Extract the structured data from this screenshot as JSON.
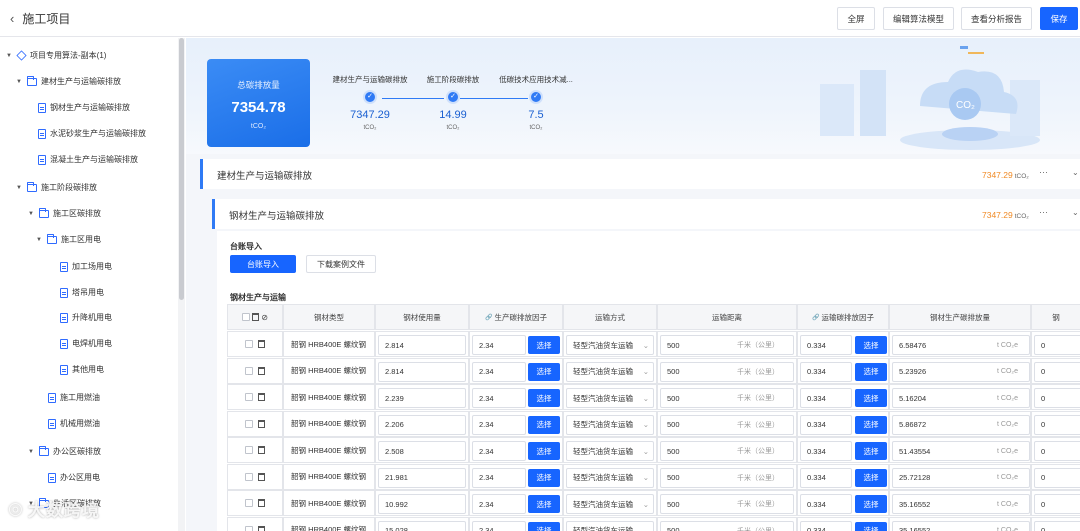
{
  "header": {
    "back_label": "施工项目",
    "buttons": [
      "全屏",
      "编辑算法模型",
      "查看分析报告",
      "保存"
    ]
  },
  "sidebar": {
    "items": [
      {
        "label": "项目专用算法-副本(1)",
        "level": 0,
        "icon": "cube-icon",
        "expandable": true
      },
      {
        "label": "建材生产与运输碳排放",
        "level": 1,
        "icon": "folder-icon",
        "expandable": true
      },
      {
        "label": "钢材生产与运输碳排放",
        "level": 2,
        "icon": "document-icon",
        "expandable": false
      },
      {
        "label": "水泥砂浆生产与运输碳排放",
        "level": 2,
        "icon": "document-icon",
        "expandable": false
      },
      {
        "label": "混凝土生产与运输碳排放",
        "level": 2,
        "icon": "document-icon",
        "expandable": false
      },
      {
        "label": "施工阶段碳排放",
        "level": 1,
        "icon": "folder-icon",
        "expandable": true
      },
      {
        "label": "施工区碳排放",
        "level": 2,
        "icon": "folder-icon",
        "expandable": true
      },
      {
        "label": "施工区用电",
        "level": 3,
        "icon": "folder-icon",
        "expandable": true
      },
      {
        "label": "加工场用电",
        "level": 4,
        "icon": "document-icon",
        "expandable": false
      },
      {
        "label": "塔吊用电",
        "level": 4,
        "icon": "document-icon",
        "expandable": false
      },
      {
        "label": "升降机用电",
        "level": 4,
        "icon": "document-icon",
        "expandable": false
      },
      {
        "label": "电焊机用电",
        "level": 4,
        "icon": "document-icon",
        "expandable": false
      },
      {
        "label": "其他用电",
        "level": 4,
        "icon": "document-icon",
        "expandable": false
      },
      {
        "label": "施工用燃油",
        "level": 3,
        "icon": "document-icon",
        "expandable": false
      },
      {
        "label": "机械用燃油",
        "level": 3,
        "icon": "document-icon",
        "expandable": false
      },
      {
        "label": "办公区碳排放",
        "level": 2,
        "icon": "folder-icon",
        "expandable": true
      },
      {
        "label": "办公区用电",
        "level": 3,
        "icon": "document-icon",
        "expandable": false
      },
      {
        "label": "生活区碳排放",
        "level": 2,
        "icon": "folder-icon",
        "expandable": true
      }
    ]
  },
  "summary": {
    "total_label": "总碳排放量",
    "total_value": "7354.78",
    "total_unit": "tCO₂",
    "steps": [
      {
        "name": "建材生产与运输碳排放",
        "value": "7347.29",
        "unit": "tCO₂"
      },
      {
        "name": "施工阶段碳排放",
        "value": "14.99",
        "unit": "tCO₂"
      },
      {
        "name": "低碳技术应用技术减...",
        "value": "7.5",
        "unit": "tCO₂"
      }
    ]
  },
  "sections": [
    {
      "title": "建材生产与运输碳排放",
      "value": "7347.29",
      "unit": "tCO₂",
      "more": "···"
    },
    {
      "title": "钢材生产与运输碳排放",
      "value": "7347.29",
      "unit": "tCO₂",
      "more": "···"
    }
  ],
  "ledger": {
    "title": "台账导入",
    "import_button": "台账导入",
    "download_button": "下载案例文件"
  },
  "table": {
    "title": "钢材生产与运输",
    "columns": [
      "钢材类型",
      "钢材使用量",
      "生产碳排放因子",
      "运输方式",
      "运输距离",
      "运输碳排放因子",
      "钢材生产碳排放量",
      "钢"
    ],
    "select_label": "选择",
    "distance_unit": "千米（公里）",
    "emission_unit": "t CO₂e",
    "rows": [
      {
        "type": "韶钢 HRB400E 螺纹钢",
        "usage": "2.814",
        "prod_factor": "2.34",
        "transport": "轻型汽油货车运输",
        "distance": "500",
        "trans_factor": "0.334",
        "emission": "6.58476",
        "extra": "0"
      },
      {
        "type": "韶钢 HRB400E 螺纹钢",
        "usage": "2.814",
        "prod_factor": "2.34",
        "transport": "轻型汽油货车运输",
        "distance": "500",
        "trans_factor": "0.334",
        "emission": "5.23926",
        "extra": "0"
      },
      {
        "type": "韶钢 HRB400E 螺纹钢",
        "usage": "2.239",
        "prod_factor": "2.34",
        "transport": "轻型汽油货车运输",
        "distance": "500",
        "trans_factor": "0.334",
        "emission": "5.16204",
        "extra": "0"
      },
      {
        "type": "韶钢 HRB400E 螺纹钢",
        "usage": "2.206",
        "prod_factor": "2.34",
        "transport": "轻型汽油货车运输",
        "distance": "500",
        "trans_factor": "0.334",
        "emission": "5.86872",
        "extra": "0"
      },
      {
        "type": "韶钢 HRB400E 螺纹钢",
        "usage": "2.508",
        "prod_factor": "2.34",
        "transport": "轻型汽油货车运输",
        "distance": "500",
        "trans_factor": "0.334",
        "emission": "51.43554",
        "extra": "0"
      },
      {
        "type": "韶钢 HRB400E 螺纹钢",
        "usage": "21.981",
        "prod_factor": "2.34",
        "transport": "轻型汽油货车运输",
        "distance": "500",
        "trans_factor": "0.334",
        "emission": "25.72128",
        "extra": "0"
      },
      {
        "type": "韶钢 HRB400E 螺纹钢",
        "usage": "10.992",
        "prod_factor": "2.34",
        "transport": "轻型汽油货车运输",
        "distance": "500",
        "trans_factor": "0.334",
        "emission": "35.16552",
        "extra": "0"
      },
      {
        "type": "韶钢 HRB400E 螺纹钢",
        "usage": "15.028",
        "prod_factor": "2.34",
        "transport": "轻型汽油货车运输",
        "distance": "500",
        "trans_factor": "0.334",
        "emission": "35.16552",
        "extra": "0"
      }
    ]
  },
  "watermark": "大数跨境",
  "colors": {
    "primary": "#1765ff",
    "accent": "#f08a24",
    "section_bar": "#2f7af5"
  }
}
